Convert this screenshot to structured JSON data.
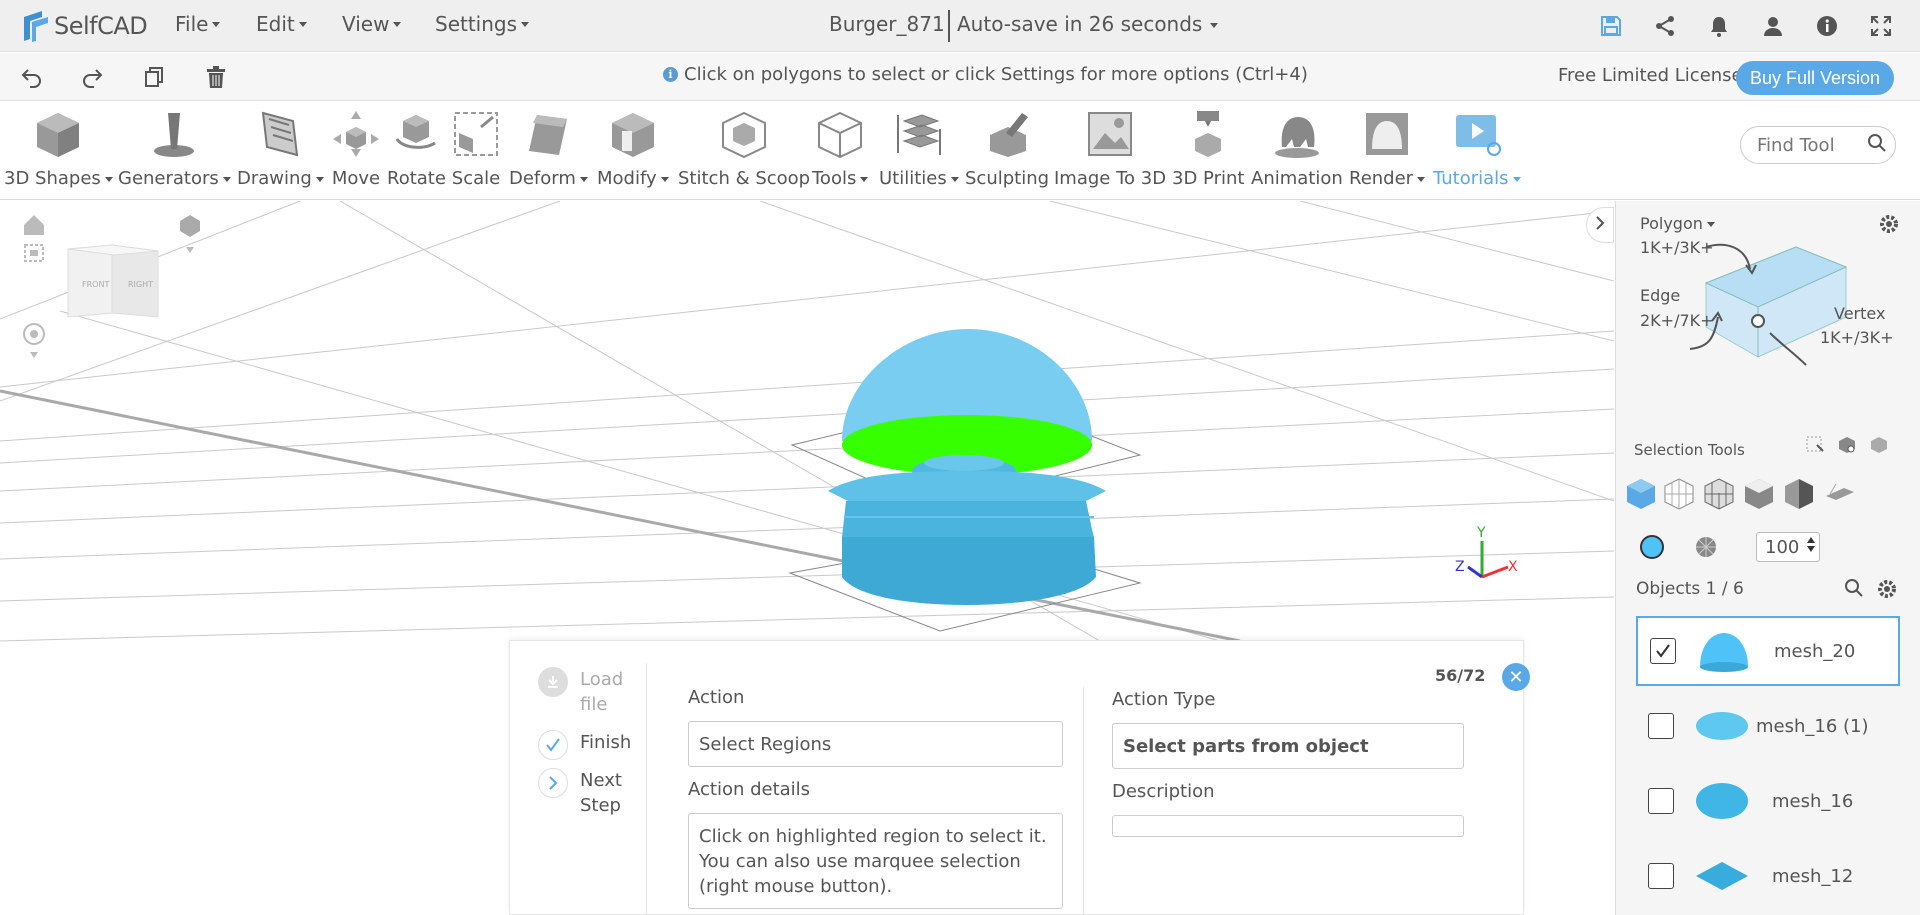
{
  "app": {
    "logo_text": "SelfCAD",
    "brand_color": "#5aa9e6"
  },
  "menu": [
    {
      "label": "File"
    },
    {
      "label": "Edit"
    },
    {
      "label": "View"
    },
    {
      "label": "Settings"
    }
  ],
  "document": {
    "title": "Burger_871",
    "autosave": "Auto-save in 26 seconds"
  },
  "top_icons": [
    "save-icon",
    "share-icon",
    "bell-icon",
    "user-icon",
    "info-icon",
    "fullscreen-icon"
  ],
  "infobar": {
    "hint": "Click on polygons to select or click Settings for more options (Ctrl+4)",
    "license": "Free Limited License",
    "buy_label": "Buy Full Version"
  },
  "toolbar": {
    "items": [
      {
        "label": "3D Shapes",
        "dropdown": true
      },
      {
        "label": "Generators",
        "dropdown": true
      },
      {
        "label": "Drawing",
        "dropdown": true
      },
      {
        "label": "Move"
      },
      {
        "label": "Rotate"
      },
      {
        "label": "Scale"
      },
      {
        "label": "Deform",
        "dropdown": true
      },
      {
        "label": "Modify",
        "dropdown": true
      },
      {
        "label": "Stitch & Scoop"
      },
      {
        "label": "Tools",
        "dropdown": true
      },
      {
        "label": "Utilities",
        "dropdown": true
      },
      {
        "label": "Sculpting"
      },
      {
        "label": "Image To 3D"
      },
      {
        "label": "3D Print"
      },
      {
        "label": "Animation"
      },
      {
        "label": "Render",
        "dropdown": true
      },
      {
        "label": "Tutorials",
        "dropdown": true
      }
    ],
    "find_placeholder": "Find Tool"
  },
  "viewcube": {
    "front": "FRONT",
    "right": "RIGHT"
  },
  "axes": {
    "x": "X",
    "y": "Y",
    "z": "Z"
  },
  "tutorial": {
    "steps": [
      {
        "label": "Load file"
      },
      {
        "label": "Finish"
      },
      {
        "label": "Next Step"
      }
    ],
    "counter": "56/72",
    "action_label": "Action",
    "action_value": "Select Regions",
    "action_details_label": "Action details",
    "action_details": "Click on highlighted region to select it. You can also use marquee selection (right mouse button).",
    "action_type_label": "Action Type",
    "action_type_value": "Select parts from object",
    "description_label": "Description",
    "description_value": ""
  },
  "selection_panel": {
    "polygon_label": "Polygon",
    "polygon_count": "1K+/3K+",
    "edge_label": "Edge",
    "edge_count": "2K+/7K+",
    "vertex_label": "Vertex",
    "vertex_count": "1K+/3K+",
    "selection_tools_label": "Selection Tools",
    "brush_size": "100",
    "objects_label": "Objects 1 / 6"
  },
  "objects": [
    {
      "name": "mesh_20",
      "checked": true
    },
    {
      "name": "mesh_16 (1)",
      "checked": false
    },
    {
      "name": "mesh_16",
      "checked": false
    },
    {
      "name": "mesh_12",
      "checked": false
    }
  ]
}
